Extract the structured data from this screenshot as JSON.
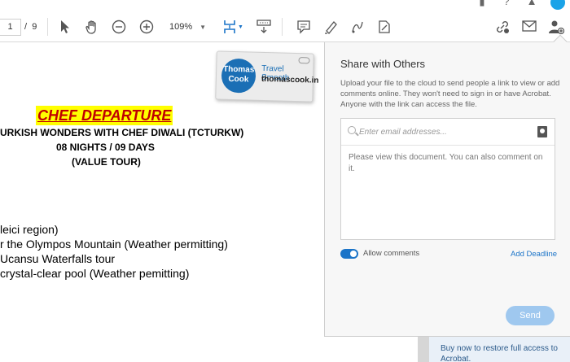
{
  "toolbar": {
    "page_current": "1",
    "page_separator": "/",
    "page_total": "9",
    "zoom": "109%",
    "icons": [
      "select-arrow-icon",
      "hand-icon",
      "zoom-out-icon",
      "zoom-in-icon",
      "fit-page-icon",
      "scroll-mode-icon",
      "comment-icon",
      "highlight-pen-icon",
      "draw-icon",
      "fill-sign-icon",
      "share-link-icon",
      "email-icon",
      "share-user-icon"
    ]
  },
  "document": {
    "logo": {
      "brand_line1": "Thomas",
      "brand_line2": "Cook",
      "tagline": "Travel Smooth",
      "site": "thomascook.in"
    },
    "title": "CHEF DEPARTURE",
    "subtitle_lines": [
      "URKISH WONDERS WITH CHEF DIWALI (TCTURKW)",
      "08 NIGHTS / 09 DAYS",
      "(VALUE TOUR)"
    ],
    "body_lines": [
      "leici region)",
      "r the Olympos Mountain (Weather permitting)",
      "Ucansu Waterfalls tour",
      "crystal-clear pool (Weather pemitting)"
    ]
  },
  "share_panel": {
    "title": "Share with Others",
    "description": "Upload your file to the cloud to send people a link to view or add comments online. They won't need to sign in or have Acrobat. Anyone with the link can access the file.",
    "email_placeholder": "Enter email addresses...",
    "message": "Please view this document. You can also comment on it.",
    "allow_comments_label": "Allow comments",
    "allow_comments_enabled": true,
    "deadline_link": "Add Deadline",
    "send_label": "Send"
  },
  "footer": {
    "buy_text": "Buy now to restore full access to Acrobat."
  },
  "colors": {
    "accent": "#1b74c8",
    "send_disabled": "#9fc8ef",
    "title_red": "#c00000",
    "title_highlight": "#ffff00"
  }
}
